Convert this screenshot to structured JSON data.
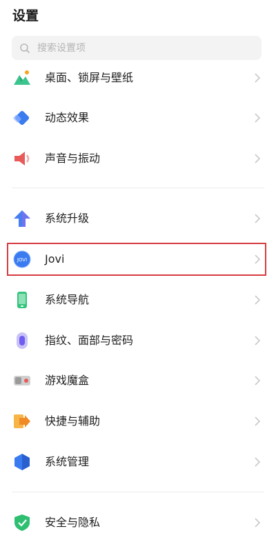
{
  "header": {
    "title": "设置"
  },
  "search": {
    "placeholder": "搜索设置项",
    "icon": "search-icon"
  },
  "items": [
    {
      "label": "桌面、锁屏与壁纸",
      "icon": "wallpaper-icon"
    },
    {
      "label": "动态效果",
      "icon": "motion-effect-icon"
    },
    {
      "label": "声音与振动",
      "icon": "speaker-icon"
    },
    {
      "label": "系统升级",
      "icon": "upgrade-arrow-icon"
    },
    {
      "label": "Jovi",
      "icon": "jovi-icon"
    },
    {
      "label": "系统导航",
      "icon": "phone-navigation-icon"
    },
    {
      "label": "指纹、面部与密码",
      "icon": "fingerprint-icon"
    },
    {
      "label": "游戏魔盒",
      "icon": "game-box-icon"
    },
    {
      "label": "快捷与辅助",
      "icon": "shortcut-arrow-icon"
    },
    {
      "label": "系统管理",
      "icon": "system-management-icon"
    },
    {
      "label": "安全与隐私",
      "icon": "shield-icon"
    }
  ],
  "colors": {
    "highlight": "#d63a3f",
    "accent": "#3a7bf0"
  }
}
